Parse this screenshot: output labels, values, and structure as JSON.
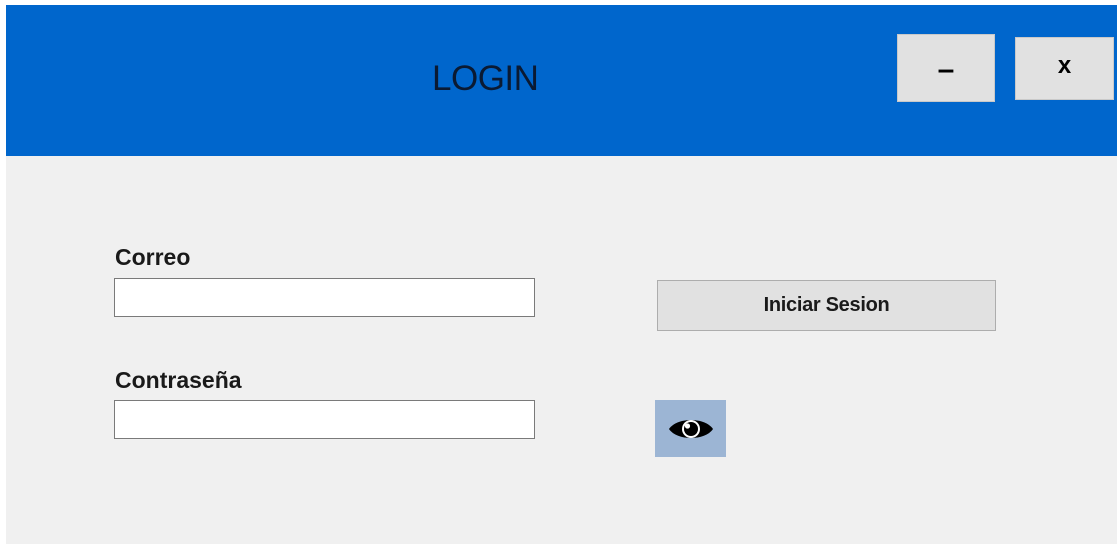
{
  "window": {
    "title": "LOGIN",
    "minimize_label": "–",
    "close_label": "x"
  },
  "form": {
    "email_label": "Correo",
    "email_value": "",
    "password_label": "Contraseña",
    "password_value": "",
    "submit_label": "Iniciar Sesion",
    "show_password_icon": "eye-icon"
  },
  "colors": {
    "header": "#0066cc",
    "background": "#f0f0f0",
    "eye_button": "#9cb5d4"
  }
}
